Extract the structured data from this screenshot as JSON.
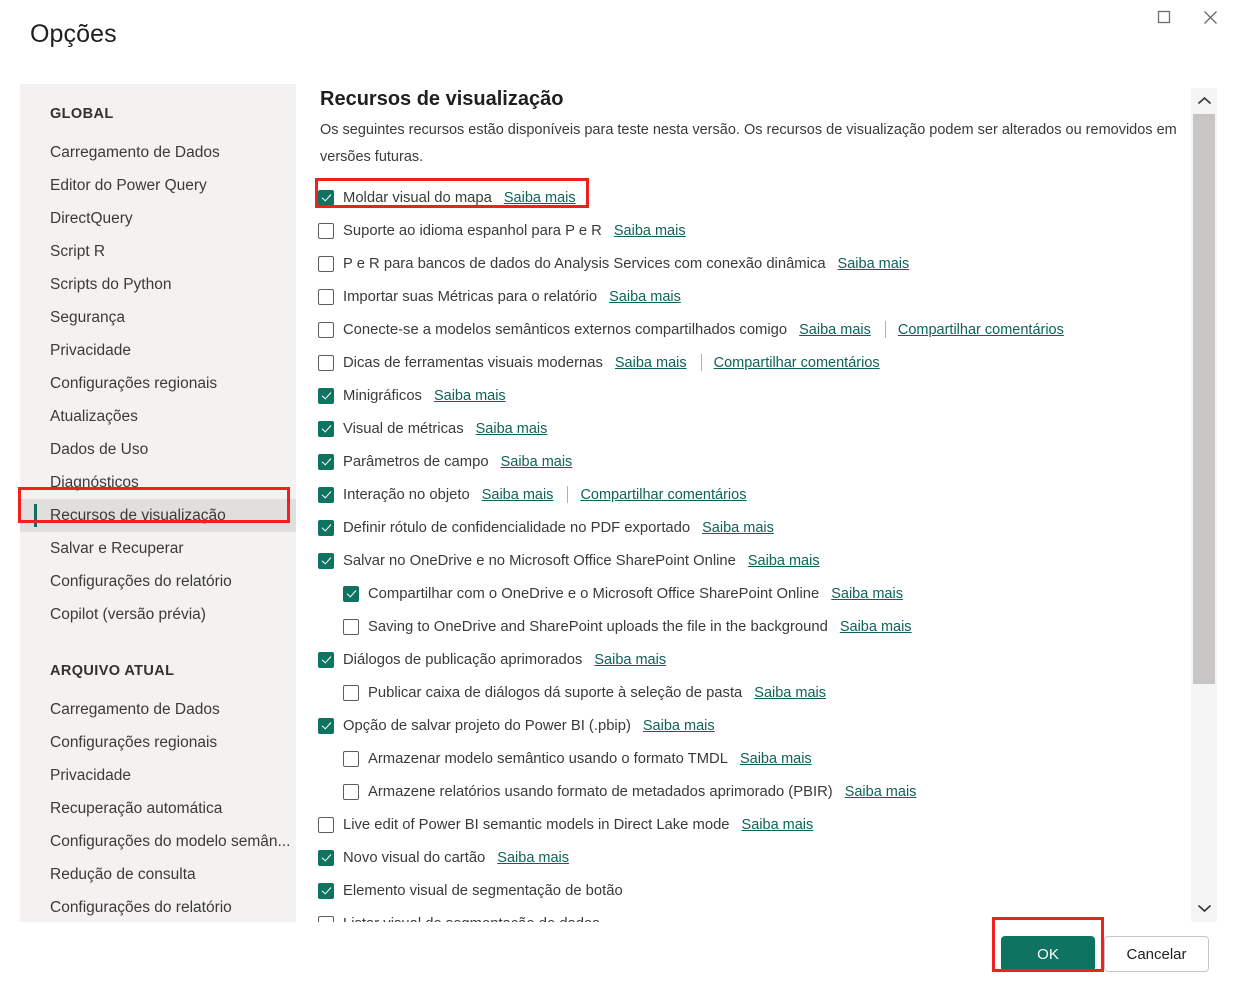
{
  "window": {
    "title": "Opções",
    "controls": [
      {
        "name": "maximize-button",
        "icon": "square-icon"
      },
      {
        "name": "close-button",
        "icon": "close-icon"
      }
    ]
  },
  "sidebar": {
    "groups": [
      {
        "title": "GLOBAL",
        "items": [
          {
            "label": "Carregamento de Dados",
            "selected": false
          },
          {
            "label": "Editor do Power Query",
            "selected": false
          },
          {
            "label": "DirectQuery",
            "selected": false
          },
          {
            "label": "Script R",
            "selected": false
          },
          {
            "label": "Scripts do Python",
            "selected": false
          },
          {
            "label": "Segurança",
            "selected": false
          },
          {
            "label": "Privacidade",
            "selected": false
          },
          {
            "label": "Configurações regionais",
            "selected": false
          },
          {
            "label": "Atualizações",
            "selected": false
          },
          {
            "label": "Dados de Uso",
            "selected": false
          },
          {
            "label": "Diagnósticos",
            "selected": false
          },
          {
            "label": "Recursos de visualização",
            "selected": true
          },
          {
            "label": "Salvar e Recuperar",
            "selected": false
          },
          {
            "label": "Configurações do relatório",
            "selected": false
          },
          {
            "label": "Copilot (versão prévia)",
            "selected": false
          }
        ]
      },
      {
        "title": "ARQUIVO ATUAL",
        "items": [
          {
            "label": "Carregamento de Dados",
            "selected": false
          },
          {
            "label": "Configurações regionais",
            "selected": false
          },
          {
            "label": "Privacidade",
            "selected": false
          },
          {
            "label": "Recuperação automática",
            "selected": false
          },
          {
            "label": "Configurações do modelo semân...",
            "selected": false
          },
          {
            "label": "Redução de consulta",
            "selected": false
          },
          {
            "label": "Configurações do relatório",
            "selected": false
          }
        ]
      }
    ]
  },
  "main": {
    "title": "Recursos de visualização",
    "description": "Os seguintes recursos estão disponíveis para teste nesta versão. Os recursos de visualização podem ser alterados ou removidos em versões futuras.",
    "learn_more_label": "Saiba mais",
    "share_feedback_label": "Compartilhar comentários",
    "features": [
      {
        "label": "Moldar visual do mapa",
        "checked": true,
        "indent": false,
        "learn_more": true,
        "feedback": false,
        "highlighted": true
      },
      {
        "label": "Suporte ao idioma espanhol para P e R",
        "checked": false,
        "indent": false,
        "learn_more": true,
        "feedback": false,
        "highlighted": false
      },
      {
        "label": "P e R para bancos de dados do Analysis Services com conexão dinâmica",
        "checked": false,
        "indent": false,
        "learn_more": true,
        "feedback": false,
        "highlighted": false
      },
      {
        "label": "Importar suas Métricas para o relatório",
        "checked": false,
        "indent": false,
        "learn_more": true,
        "feedback": false,
        "highlighted": false
      },
      {
        "label": "Conecte-se a modelos semânticos externos compartilhados comigo",
        "checked": false,
        "indent": false,
        "learn_more": true,
        "feedback": true,
        "highlighted": false
      },
      {
        "label": "Dicas de ferramentas visuais modernas",
        "checked": false,
        "indent": false,
        "learn_more": true,
        "feedback": true,
        "highlighted": false
      },
      {
        "label": "Minigráficos",
        "checked": true,
        "indent": false,
        "learn_more": true,
        "feedback": false,
        "highlighted": false
      },
      {
        "label": "Visual de métricas",
        "checked": true,
        "indent": false,
        "learn_more": true,
        "feedback": false,
        "highlighted": false
      },
      {
        "label": "Parâmetros de campo",
        "checked": true,
        "indent": false,
        "learn_more": true,
        "feedback": false,
        "highlighted": false
      },
      {
        "label": "Interação no objeto",
        "checked": true,
        "indent": false,
        "learn_more": true,
        "feedback": true,
        "highlighted": false
      },
      {
        "label": "Definir rótulo de confidencialidade no PDF exportado",
        "checked": true,
        "indent": false,
        "learn_more": true,
        "feedback": false,
        "highlighted": false
      },
      {
        "label": "Salvar no OneDrive e no Microsoft Office SharePoint Online",
        "checked": true,
        "indent": false,
        "learn_more": true,
        "feedback": false,
        "highlighted": false
      },
      {
        "label": "Compartilhar com o OneDrive e o Microsoft Office SharePoint Online",
        "checked": true,
        "indent": true,
        "learn_more": true,
        "feedback": false,
        "highlighted": false
      },
      {
        "label": "Saving to OneDrive and SharePoint uploads the file in the background",
        "checked": false,
        "indent": true,
        "learn_more": true,
        "feedback": false,
        "highlighted": false
      },
      {
        "label": "Diálogos de publicação aprimorados",
        "checked": true,
        "indent": false,
        "learn_more": true,
        "feedback": false,
        "highlighted": false
      },
      {
        "label": "Publicar caixa de diálogos dá suporte à seleção de pasta",
        "checked": false,
        "indent": true,
        "learn_more": true,
        "feedback": false,
        "highlighted": false
      },
      {
        "label": "Opção de salvar projeto do Power BI (.pbip)",
        "checked": true,
        "indent": false,
        "learn_more": true,
        "feedback": false,
        "highlighted": false
      },
      {
        "label": "Armazenar modelo semântico usando o formato TMDL",
        "checked": false,
        "indent": true,
        "learn_more": true,
        "feedback": false,
        "highlighted": false
      },
      {
        "label": "Armazene relatórios usando formato de metadados aprimorado (PBIR)",
        "checked": false,
        "indent": true,
        "learn_more": true,
        "feedback": false,
        "highlighted": false
      },
      {
        "label": "Live edit of Power BI semantic models in Direct Lake mode",
        "checked": false,
        "indent": false,
        "learn_more": true,
        "feedback": false,
        "highlighted": false
      },
      {
        "label": "Novo visual do cartão",
        "checked": true,
        "indent": false,
        "learn_more": true,
        "feedback": false,
        "highlighted": false
      },
      {
        "label": "Elemento visual de segmentação de botão",
        "checked": true,
        "indent": false,
        "learn_more": false,
        "feedback": false,
        "highlighted": false
      },
      {
        "label": "Listar visual de segmentação de dados",
        "checked": false,
        "indent": false,
        "learn_more": false,
        "feedback": false,
        "highlighted": false
      }
    ]
  },
  "scrollbar": {
    "up_icon": "chevron-up-icon",
    "down_icon": "chevron-down-icon"
  },
  "footer": {
    "ok_label": "OK",
    "cancel_label": "Cancelar"
  },
  "colors": {
    "accent": "#0f7361",
    "link": "#0f6258",
    "highlight": "#f02020",
    "sidebar_bg": "#f3f2f1",
    "selected_bg": "#e1dfdd"
  }
}
